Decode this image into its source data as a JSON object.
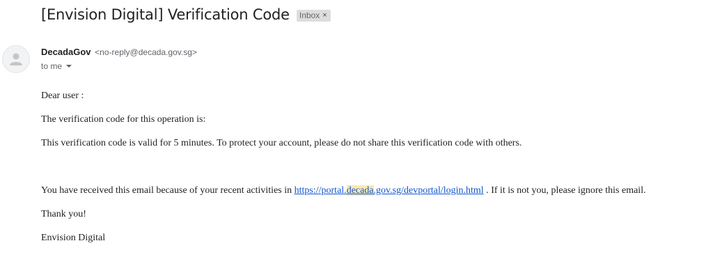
{
  "email": {
    "subject": "[Envision Digital] Verification Code",
    "label": {
      "text": "Inbox",
      "remove_glyph": "×"
    },
    "sender": {
      "name": "DecadaGov",
      "email": "<no-reply@decada.gov.sg>"
    },
    "recipient": {
      "text": "to me"
    },
    "body": {
      "greeting": "Dear user :",
      "code_line": "The verification code for this operation is:",
      "validity_line": "This verification code is valid for 5 minutes. To protect your account, please do not share this verification code with others.",
      "activity_prefix": "You have received this email because of your recent activities in ",
      "link": {
        "part_before": "https://portal.",
        "highlight": "decada",
        "part_after": ".gov.sg/devportal/login.html"
      },
      "activity_suffix": " . If it is not you, please ignore this email.",
      "thanks": "Thank you!",
      "signature": "Envision Digital"
    }
  },
  "colors": {
    "link": "#1155cc",
    "search_highlight": "#fce8b2",
    "label_chip_bg": "#dddddd",
    "avatar_bg": "#f1f3f4",
    "avatar_figure": "#c4c7c5"
  },
  "icons": {
    "avatar": "default-person-icon",
    "recipient_toggle": "caret-down-icon",
    "label_remove": "close-icon"
  }
}
